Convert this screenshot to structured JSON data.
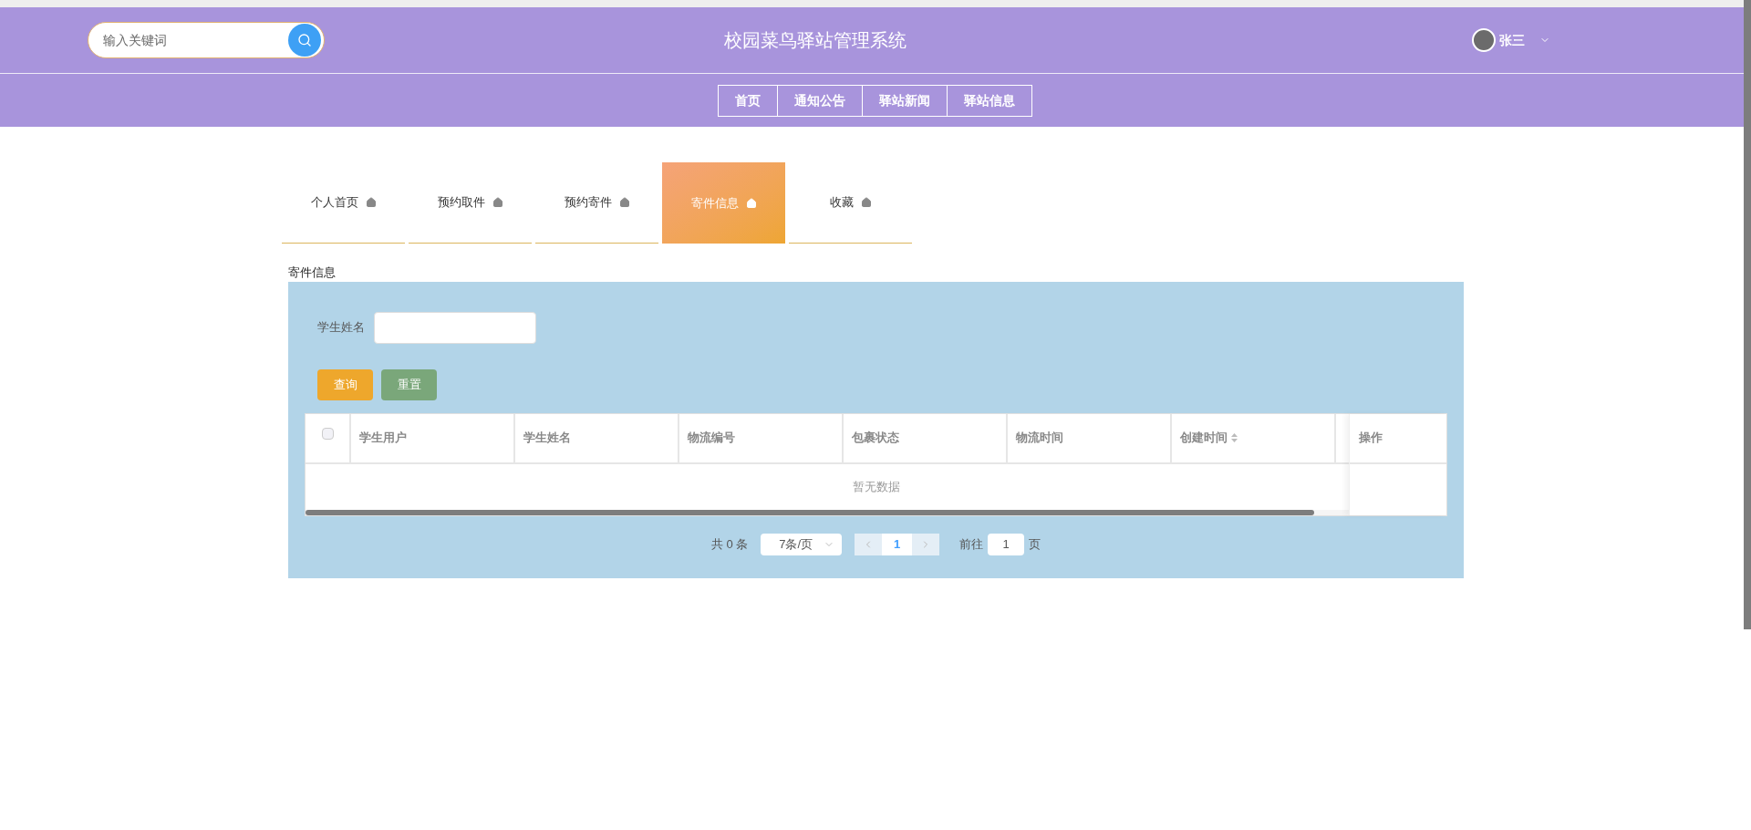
{
  "header": {
    "search": {
      "placeholder": "输入关键词"
    },
    "title": "校园菜鸟驿站管理系统",
    "user": {
      "name": "张三"
    }
  },
  "nav": [
    "首页",
    "通知公告",
    "驿站新闻",
    "驿站信息"
  ],
  "tabs": [
    {
      "label": "个人首页",
      "selected": false
    },
    {
      "label": "预约取件",
      "selected": false
    },
    {
      "label": "预约寄件",
      "selected": false
    },
    {
      "label": "寄件信息",
      "selected": true
    },
    {
      "label": "收藏",
      "selected": false
    }
  ],
  "section_title": "寄件信息",
  "filter": {
    "label": "学生姓名",
    "buttons": [
      {
        "label": "查询",
        "kind": "primary"
      },
      {
        "label": "重置",
        "kind": "secondary"
      }
    ]
  },
  "table": {
    "select_all": {
      "checked": false
    },
    "columns": [
      {
        "label": "学生用户",
        "sortable": false
      },
      {
        "label": "学生姓名",
        "sortable": false
      },
      {
        "label": "物流编号",
        "sortable": false
      },
      {
        "label": "包裹状态",
        "sortable": false
      },
      {
        "label": "物流时间",
        "sortable": false
      },
      {
        "label": "创建时间",
        "sortable": true
      }
    ],
    "action_column": "操作",
    "empty_text": "暂无数据"
  },
  "pagination": {
    "total": "共 0 条",
    "page_size": "7条/页",
    "pages": [
      {
        "label": "1",
        "selected": true
      }
    ],
    "goto_label": "前往",
    "goto_value": "1",
    "goto_suffix": "页"
  }
}
